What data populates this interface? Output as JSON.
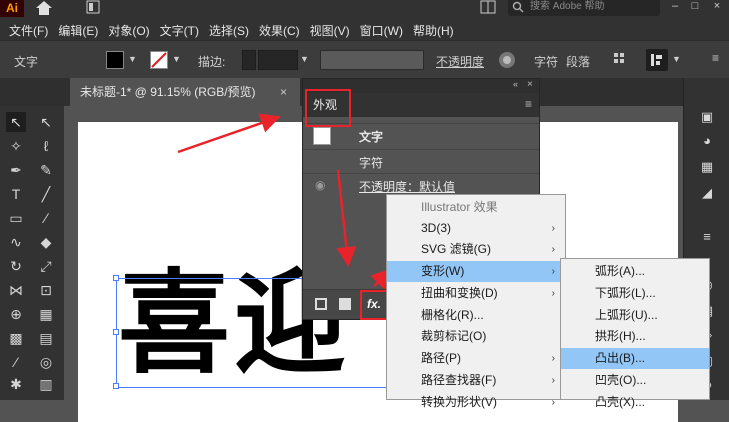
{
  "app": {
    "logo": "Ai"
  },
  "menubar": {
    "items": [
      "文件(F)",
      "编辑(E)",
      "对象(O)",
      "文字(T)",
      "选择(S)",
      "效果(C)",
      "视图(V)",
      "窗口(W)",
      "帮助(H)"
    ],
    "search_placeholder": "搜索 Adobe 帮助"
  },
  "controlbar": {
    "type_label": "文字",
    "stroke_label": "描边",
    "opacity_label": "不透明度",
    "char_label": "字符",
    "para_label": "段落"
  },
  "document": {
    "tab_title": "未标题-1* @ 91.15% (RGB/预览)",
    "close_glyph": "×",
    "text": "喜迎"
  },
  "appearance_panel": {
    "title": "外观",
    "rows": [
      "文字",
      "字符",
      "不透明度：默认值"
    ]
  },
  "effect_menu": {
    "items": [
      {
        "label": "Illustrator 效果",
        "submenu": false,
        "disabled": true
      },
      {
        "label": "3D(3)",
        "submenu": true
      },
      {
        "label": "SVG 滤镜(G)",
        "submenu": true
      },
      {
        "label": "变形(W)",
        "submenu": true,
        "highlighted": true
      },
      {
        "label": "扭曲和变换(D)",
        "submenu": true
      },
      {
        "label": "栅格化(R)...",
        "submenu": false
      },
      {
        "label": "裁剪标记(O)",
        "submenu": false
      },
      {
        "label": "路径(P)",
        "submenu": true
      },
      {
        "label": "路径查找器(F)",
        "submenu": true
      },
      {
        "label": "转换为形状(V)",
        "submenu": true
      }
    ]
  },
  "warp_submenu": {
    "items": [
      {
        "label": "弧形(A)..."
      },
      {
        "label": "下弧形(L)..."
      },
      {
        "label": "上弧形(U)..."
      },
      {
        "label": "拱形(H)..."
      },
      {
        "label": "凸出(B)...",
        "highlighted": true
      },
      {
        "label": "凹壳(O)..."
      },
      {
        "label": "凸壳(X)..."
      }
    ]
  },
  "colors": {
    "accent_red": "#e8232a",
    "highlight": "#91c6f7"
  }
}
